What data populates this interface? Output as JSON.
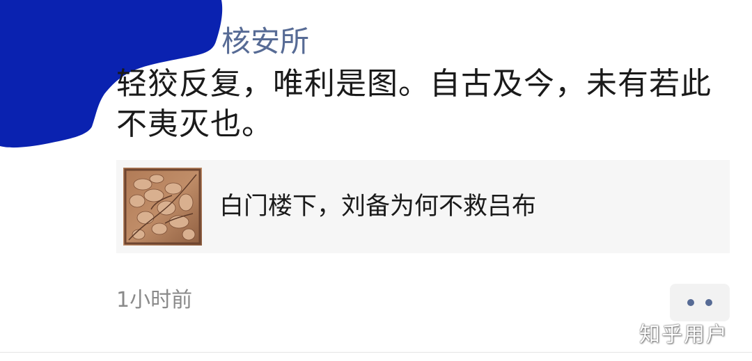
{
  "comment": {
    "author_name": "核安所",
    "text": "轻狡反复，唯利是图。自古及今，未有若此不夷灭也。",
    "timestamp": "1小时前"
  },
  "link_card": {
    "title": "白门楼下，刘备为何不救吕布",
    "thumbnail": "carved-wood-relief-image"
  },
  "more_button": {
    "icon": "more-dots-icon"
  },
  "watermark": {
    "text": "知乎用户"
  },
  "colors": {
    "author_link": "#576b95",
    "body_text": "#1a1a1a",
    "muted_text": "#8a8a8a",
    "card_bg": "#f6f6f6",
    "redaction": "#0a22b0"
  }
}
